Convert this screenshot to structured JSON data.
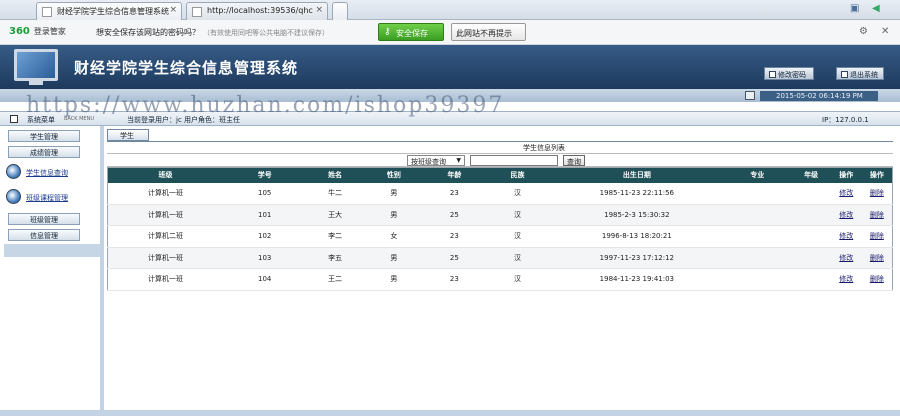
{
  "browser": {
    "tabs": [
      {
        "title": "财经学院学生综合信息管理系统"
      },
      {
        "title": "http://localhost:39536/qhc"
      }
    ]
  },
  "savebar": {
    "brand": "360",
    "brand_sub": "登录管家",
    "message": "想安全保存该网站的密码吗？",
    "hint": "（有效使用同吧等公共电脑不建议保存）",
    "save_button": "安全保存",
    "never_button": "此网站不再提示"
  },
  "header": {
    "title": "财经学院学生综合信息管理系统",
    "change_password": "修改密码",
    "exit": "退出系统",
    "datetime": "2015-05-02 06:14:19 PM"
  },
  "watermark": "https://www.huzhan.com/ishop39397",
  "menubar": {
    "label": "系统菜单",
    "sublabel": "BACK MENU",
    "current_user": "当前登录用户：jc 用户角色：班主任",
    "ip": "IP：127.0.0.1"
  },
  "nav": {
    "student_mgmt": "学生管理",
    "grade_mgmt": "成绩管理",
    "student_info_query": "学生信息查询",
    "class_info_mgmt": "班级课程管理",
    "class_mgmt": "班级管理",
    "info_mgmt": "信息管理"
  },
  "content": {
    "tab": "学生",
    "list_title": "学生信息列表",
    "select_value": "按班级查询",
    "search_button": "查询",
    "columns": [
      "班级",
      "学号",
      "姓名",
      "性别",
      "年龄",
      "民族",
      "出生日期",
      "专业",
      "年级",
      "操作",
      "操作"
    ],
    "rows": [
      [
        "计算机一班",
        "105",
        "牛二",
        "男",
        "23",
        "汉",
        "1985-11-23 22:11:56",
        "",
        "",
        "修改",
        "删除"
      ],
      [
        "计算机一班",
        "101",
        "王大",
        "男",
        "25",
        "汉",
        "1985-2-3 15:30:32",
        "",
        "",
        "修改",
        "删除"
      ],
      [
        "计算机二班",
        "102",
        "李二",
        "女",
        "23",
        "汉",
        "1996-8-13 18:20:21",
        "",
        "",
        "修改",
        "删除"
      ],
      [
        "计算机一班",
        "103",
        "李五",
        "男",
        "25",
        "汉",
        "1997-11-23 17:12:12",
        "",
        "",
        "修改",
        "删除"
      ],
      [
        "计算机一班",
        "104",
        "王二",
        "男",
        "23",
        "汉",
        "1984-11-23 19:41:03",
        "",
        "",
        "修改",
        "删除"
      ]
    ]
  }
}
